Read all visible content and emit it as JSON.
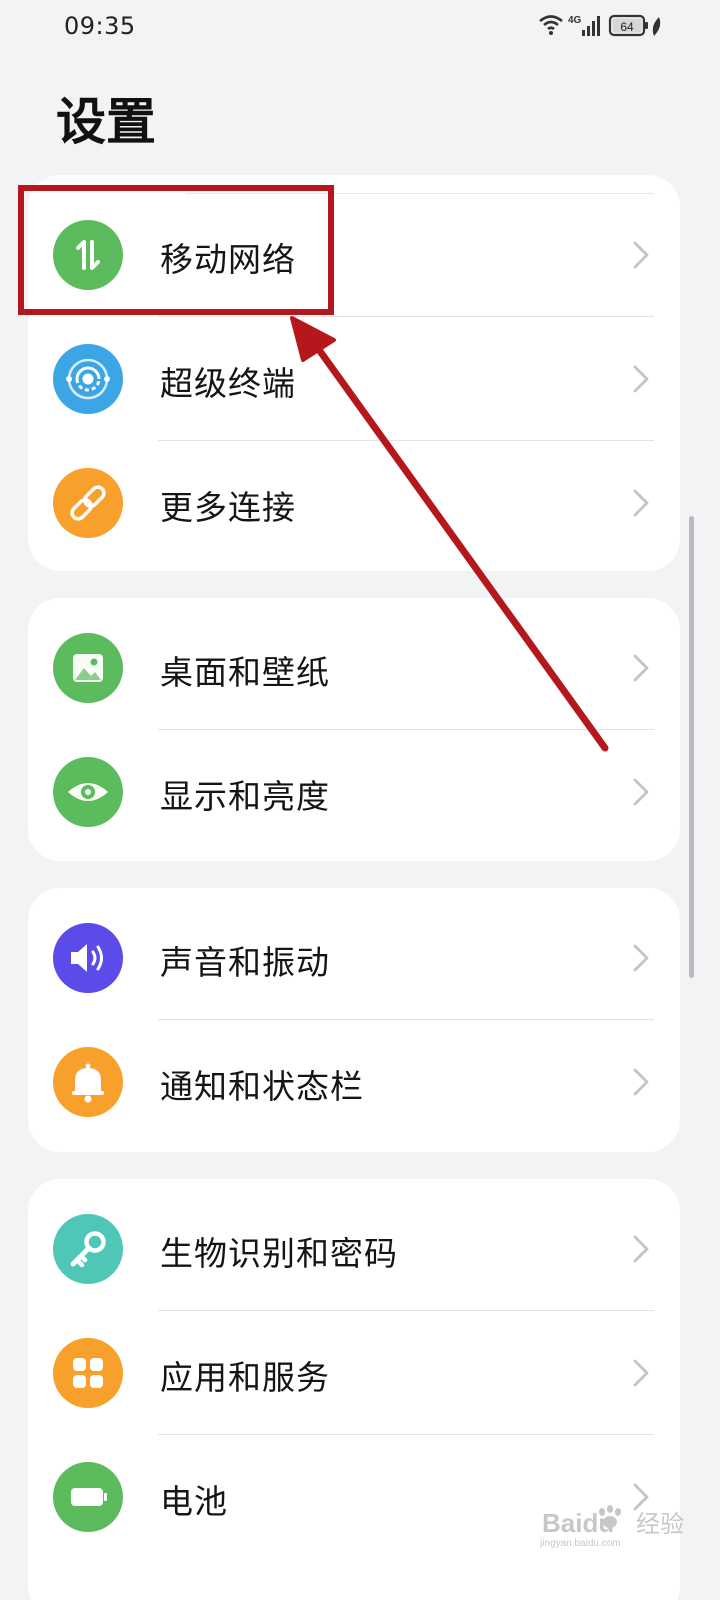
{
  "status_bar": {
    "time": "09:35",
    "network": "4G",
    "battery": "64"
  },
  "page": {
    "title": "设置"
  },
  "groups": [
    {
      "items": [
        {
          "label": "移动网络",
          "icon": "mobile-data-icon",
          "color": "#5cbb5c"
        },
        {
          "label": "超级终端",
          "icon": "super-device-icon",
          "color": "#3ba5e6"
        },
        {
          "label": "更多连接",
          "icon": "link-icon",
          "color": "#f7a12c"
        }
      ]
    },
    {
      "items": [
        {
          "label": "桌面和壁纸",
          "icon": "wallpaper-icon",
          "color": "#5cbb5c"
        },
        {
          "label": "显示和亮度",
          "icon": "eye-icon",
          "color": "#5cbb5c"
        }
      ]
    },
    {
      "items": [
        {
          "label": "声音和振动",
          "icon": "speaker-icon",
          "color": "#5b4be8"
        },
        {
          "label": "通知和状态栏",
          "icon": "bell-icon",
          "color": "#f7a12c"
        }
      ]
    },
    {
      "items": [
        {
          "label": "生物识别和密码",
          "icon": "key-icon",
          "color": "#4ec7b6"
        },
        {
          "label": "应用和服务",
          "icon": "apps-grid-icon",
          "color": "#f7a12c"
        },
        {
          "label": "电池",
          "icon": "battery-icon",
          "color": "#5cbb5c"
        }
      ]
    }
  ],
  "annotation": {
    "highlight_color": "#b4181c"
  },
  "watermark": {
    "brand": "Baidu",
    "brand_cn": "经验",
    "url": "jingyan.baidu.com"
  }
}
